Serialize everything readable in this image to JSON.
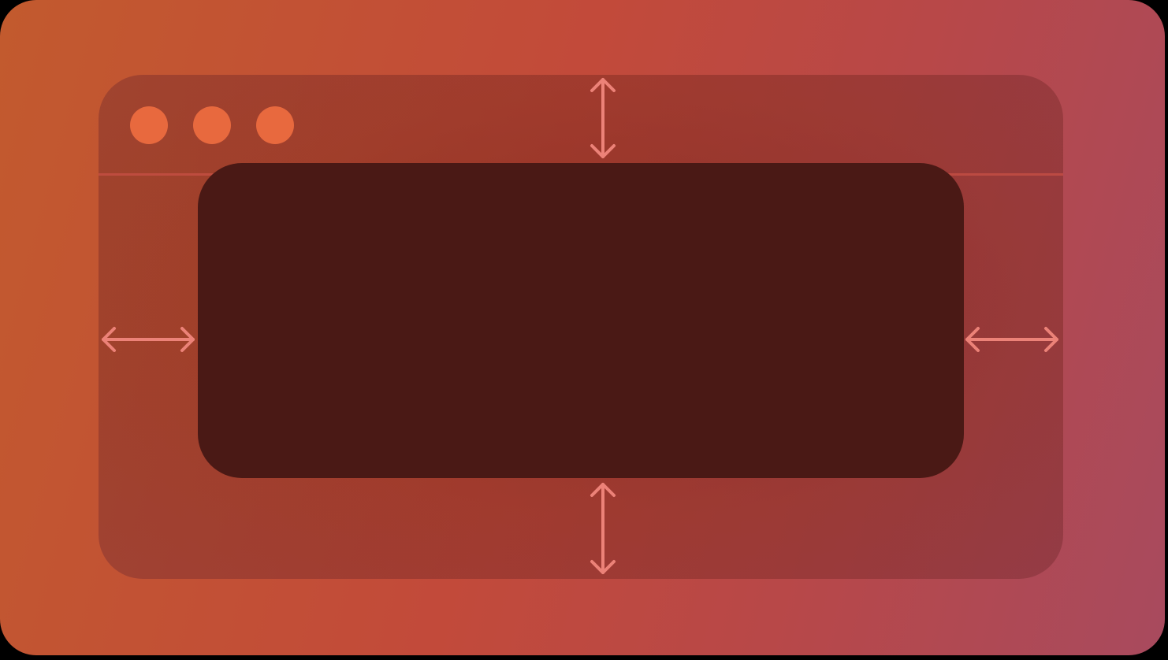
{
  "window": {
    "traffic_lights": [
      {
        "name": "close",
        "color": "#e8693e"
      },
      {
        "name": "minimize",
        "color": "#e8693e"
      },
      {
        "name": "zoom",
        "color": "#e8693e"
      }
    ]
  },
  "colors": {
    "background_start": "#c25a2e",
    "background_end": "#a84a5e",
    "content_area": "#4a1915",
    "arrow": "#ec8278",
    "traffic_light": "#e8693e"
  },
  "icons": {
    "top": "vertical-double-arrow-icon",
    "bottom": "vertical-double-arrow-icon",
    "left": "horizontal-double-arrow-icon",
    "right": "horizontal-double-arrow-icon"
  }
}
